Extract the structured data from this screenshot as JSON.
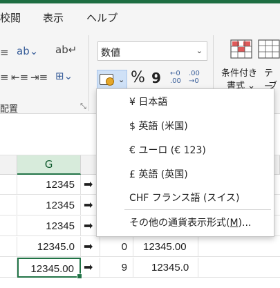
{
  "menubar": {
    "tab_review": "校閲",
    "tab_view": "表示",
    "tab_help": "ヘルプ"
  },
  "ribbon": {
    "number_format_value": "数値",
    "percent_symbol": "%",
    "comma_symbol": "9",
    "increase_decimal": "←0\n.00",
    "decrease_decimal": ".00\n→0",
    "alignment_group_label": "配置",
    "conditional_format_label_1": "条件付き",
    "conditional_format_label_2": "書式 ⌄",
    "table_format_label_1": "テー",
    "table_format_label_2": "ブ"
  },
  "currency_menu": {
    "items": [
      "¥ 日本語",
      "$ 英語 (米国)",
      "€ ユーロ (€ 123)",
      "£ 英語 (英国)",
      "CHF フランス語 (スイス)"
    ],
    "more_prefix": "その他の通貨表示形式(",
    "more_accel": "M",
    "more_suffix": ")..."
  },
  "sheet": {
    "column_g": "G",
    "rows": [
      {
        "g": "12345",
        "arrow": "➡",
        "h": "",
        "i": ""
      },
      {
        "g": "12345",
        "arrow": "➡",
        "h": "",
        "i": ""
      },
      {
        "g": "12345",
        "arrow": "➡",
        "h": "",
        "i": ""
      },
      {
        "g": "12345.0",
        "arrow": "➡",
        "h": "0",
        "i": "12345.00"
      },
      {
        "g": "12345.00",
        "arrow": "➡",
        "h": "9",
        "i": "12345.0"
      }
    ]
  },
  "colors": {
    "accent_green": "#217346",
    "highlight_blue": "#cfe1f7"
  }
}
